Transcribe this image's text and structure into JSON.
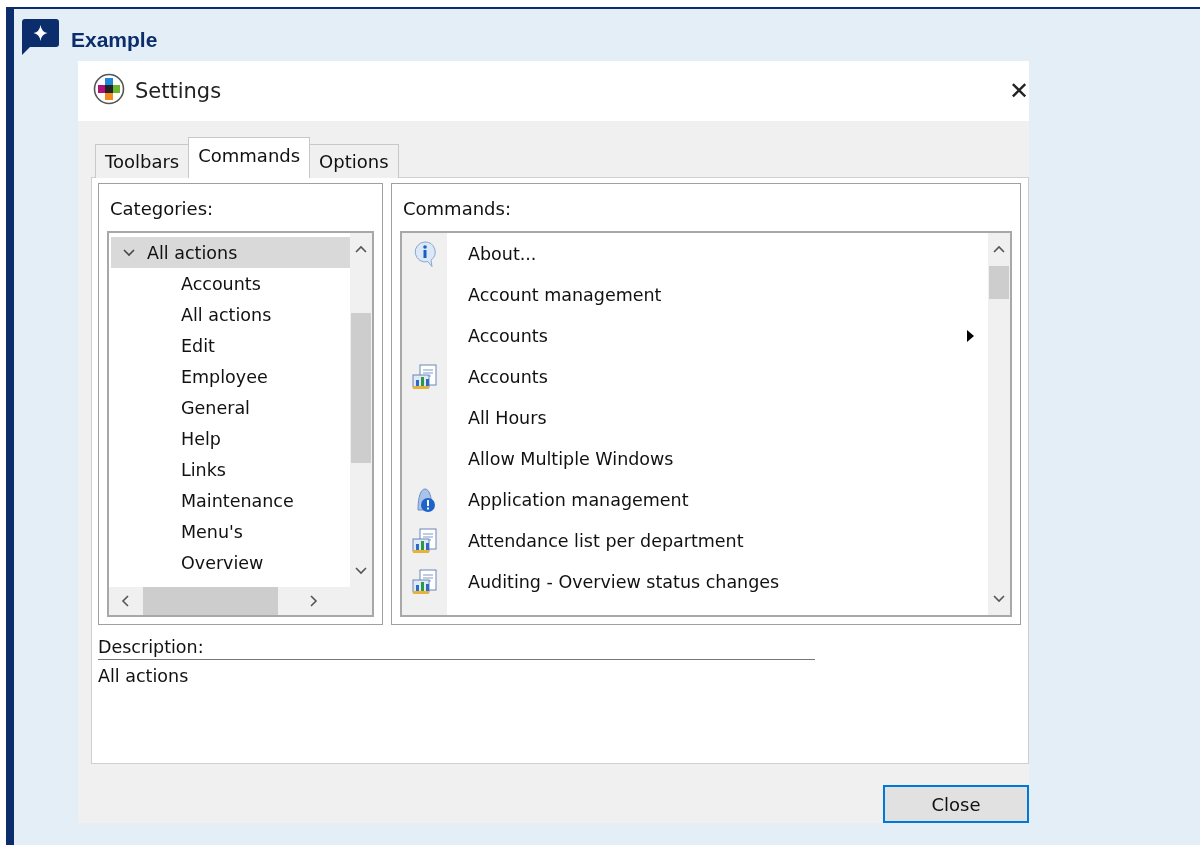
{
  "header": {
    "title": "Example"
  },
  "window": {
    "title": "Settings",
    "close_glyph": "✕"
  },
  "tabs": [
    {
      "label": "Toolbars",
      "selected": false
    },
    {
      "label": "Commands",
      "selected": true
    },
    {
      "label": "Options",
      "selected": false
    }
  ],
  "categories": {
    "label": "Categories:",
    "items": [
      {
        "label": "All actions",
        "expanded": true,
        "selected": true,
        "children": [
          {
            "label": "Accounts",
            "selected": false
          },
          {
            "label": "All actions",
            "selected": false
          },
          {
            "label": "Edit",
            "selected": false
          },
          {
            "label": "Employee",
            "selected": false
          },
          {
            "label": "General",
            "selected": false
          },
          {
            "label": "Help",
            "selected": false
          },
          {
            "label": "Links",
            "selected": false
          },
          {
            "label": "Maintenance",
            "selected": false
          },
          {
            "label": "Menu's",
            "selected": false
          },
          {
            "label": "Overview",
            "selected": false
          }
        ]
      }
    ]
  },
  "commands": {
    "label": "Commands:",
    "items": [
      {
        "label": "About...",
        "kind": "info",
        "submenu": false
      },
      {
        "label": "Account management",
        "kind": "plain",
        "submenu": false
      },
      {
        "label": "Accounts",
        "kind": "plain",
        "submenu": true
      },
      {
        "label": "Accounts",
        "kind": "report",
        "submenu": false
      },
      {
        "label": "All Hours",
        "kind": "plain",
        "submenu": false
      },
      {
        "label": "Allow Multiple Windows",
        "kind": "plain",
        "submenu": false
      },
      {
        "label": "Application management",
        "kind": "alert",
        "submenu": false
      },
      {
        "label": "Attendance list per department",
        "kind": "report",
        "submenu": false
      },
      {
        "label": "Auditing - Overview status changes",
        "kind": "report",
        "submenu": false
      }
    ]
  },
  "description": {
    "label": "Description:",
    "text": "All actions"
  },
  "buttons": [
    {
      "label": "Close",
      "default": true
    }
  ]
}
